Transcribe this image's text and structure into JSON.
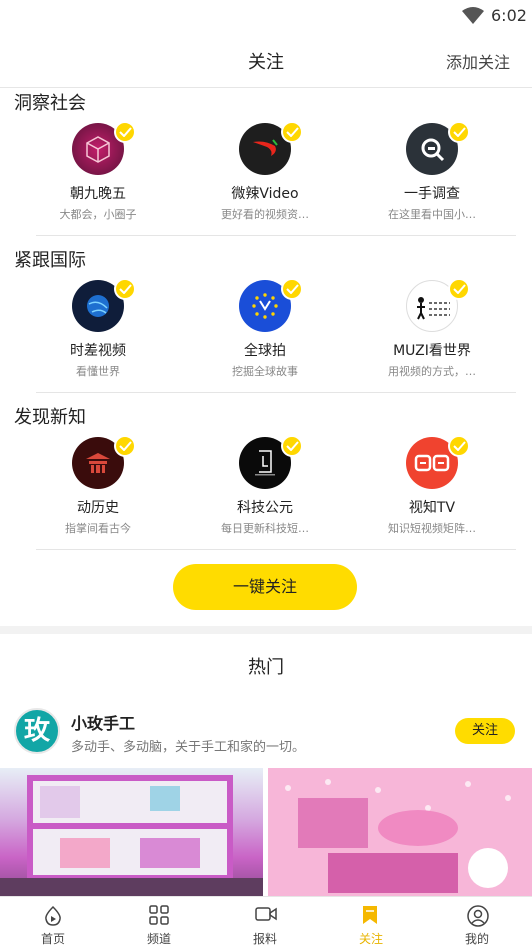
{
  "status_bar": {
    "time": "6:02"
  },
  "header": {
    "title": "关注",
    "add_follow": "添加关注"
  },
  "sections": [
    {
      "title": "洞察社会",
      "items": [
        {
          "name": "朝九晚五",
          "desc": "大都会，小圈子"
        },
        {
          "name": "微辣Video",
          "desc": "更好看的视频资…"
        },
        {
          "name": "一手调查",
          "desc": "在这里看中国小…"
        }
      ]
    },
    {
      "title": "紧跟国际",
      "items": [
        {
          "name": "时差视频",
          "desc": "看懂世界"
        },
        {
          "name": "全球拍",
          "desc": "挖掘全球故事"
        },
        {
          "name": "MUZI看世界",
          "desc": "用视频的方式，…"
        }
      ]
    },
    {
      "title": "发现新知",
      "items": [
        {
          "name": "动历史",
          "desc": "指掌间看古今"
        },
        {
          "name": "科技公元",
          "desc": "每日更新科技短…"
        },
        {
          "name": "视知TV",
          "desc": "知识短视频矩阵…"
        }
      ]
    }
  ],
  "follow_all": "一键关注",
  "hot": {
    "title": "热门",
    "channel": {
      "logo_text": "玫",
      "name": "小玫手工",
      "desc": "多动手、多动脑，关于手工和家的一切。",
      "follow": "关注"
    }
  },
  "tabs": [
    {
      "label": "首页",
      "icon": "home-icon"
    },
    {
      "label": "频道",
      "icon": "grid-icon"
    },
    {
      "label": "报料",
      "icon": "video-camera-icon"
    },
    {
      "label": "关注",
      "icon": "bookmark-icon"
    },
    {
      "label": "我的",
      "icon": "user-icon"
    }
  ],
  "colors": {
    "accent": "#ffdc00",
    "active_tab": "#e8b400"
  }
}
